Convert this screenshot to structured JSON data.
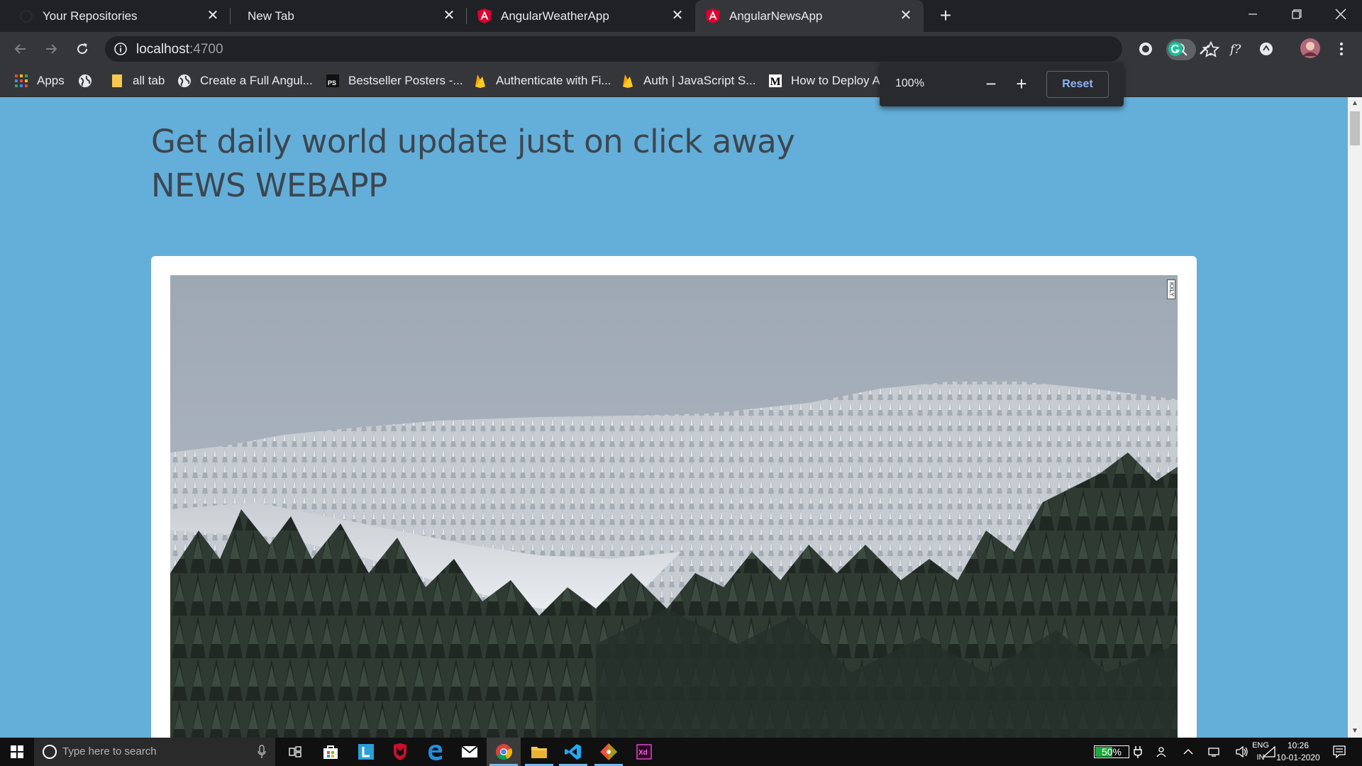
{
  "browser": {
    "tabs": [
      {
        "title": "Your Repositories",
        "favicon": "github-icon",
        "active": false
      },
      {
        "title": "New Tab",
        "favicon": "",
        "active": false
      },
      {
        "title": "AngularWeatherApp",
        "favicon": "angular-icon",
        "active": false
      },
      {
        "title": "AngularNewsApp",
        "favicon": "angular-icon",
        "active": true
      }
    ],
    "new_tab_symbol": "+",
    "close_symbol": "✕",
    "address": {
      "host": "localhost",
      "port": ":4700"
    },
    "zoom_popup": {
      "level": "100%",
      "minus": "−",
      "plus": "+",
      "reset_label": "Reset"
    },
    "bookmarks": [
      {
        "label": "Apps",
        "icon": "apps-grid-icon"
      },
      {
        "label": "",
        "icon": "globe-icon"
      },
      {
        "label": "all tab",
        "icon": "folder-icon"
      },
      {
        "label": "Create a Full Angul...",
        "icon": "globe-icon"
      },
      {
        "label": "Bestseller Posters -...",
        "icon": "ps-icon"
      },
      {
        "label": "Authenticate with Fi...",
        "icon": "firebase-icon"
      },
      {
        "label": "Auth | JavaScript S...",
        "icon": "firebase-icon"
      },
      {
        "label": "How to Deploy Ar",
        "icon": "medium-icon"
      }
    ]
  },
  "page": {
    "headline": "Get daily world update just on click away",
    "brand": "NEWS WEBAPP",
    "image_watermark": "KXLY"
  },
  "taskbar": {
    "search_placeholder": "Type here to search",
    "battery": "50%",
    "battery_level": 0.5,
    "lang_line1": "ENG",
    "lang_line2": "IN",
    "time": "10:26",
    "date": "10-01-2020"
  },
  "colors": {
    "page_background": "#64afd9",
    "heading_text": "#3c4650",
    "chrome_dark": "#202124",
    "chrome_toolbar": "#35363a",
    "reset_blue": "#8ab4f8"
  }
}
